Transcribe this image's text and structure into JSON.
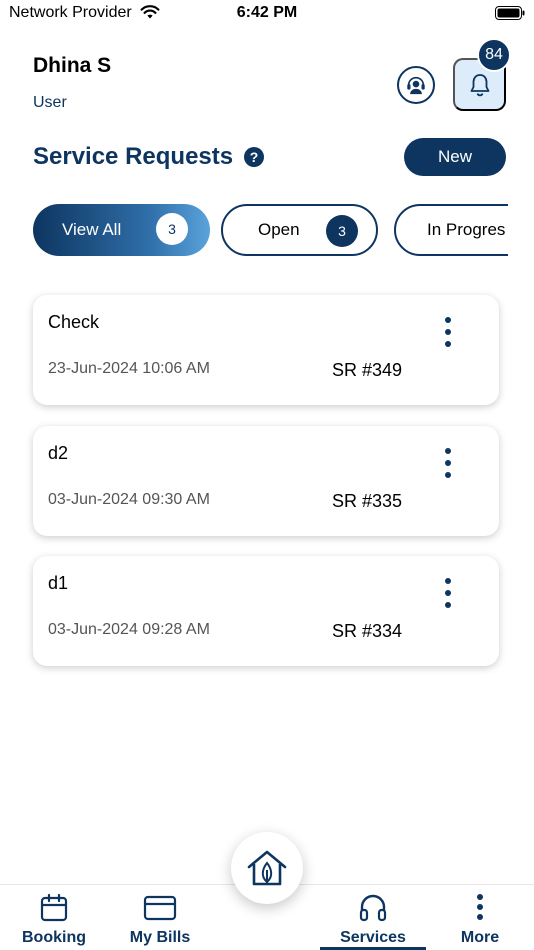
{
  "status_bar": {
    "carrier": "Network Provider",
    "time": "6:42 PM"
  },
  "header": {
    "user_name": "Dhina S",
    "user_role": "User",
    "notification_count": "84",
    "support_icon": "support-agent-icon",
    "bell_icon": "bell-icon"
  },
  "section": {
    "title": "Service Requests",
    "help_symbol": "?",
    "new_button": "New"
  },
  "filters": [
    {
      "label": "View All",
      "count": "3",
      "active": true
    },
    {
      "label": "Open",
      "count": "3",
      "active": false
    },
    {
      "label": "In Progres",
      "count": "",
      "active": false
    }
  ],
  "requests": [
    {
      "title": "Check",
      "date": "23-Jun-2024 10:06 AM",
      "sr": "SR #349"
    },
    {
      "title": "d2",
      "date": "03-Jun-2024 09:30 AM",
      "sr": "SR #335"
    },
    {
      "title": "d1",
      "date": "03-Jun-2024 09:28 AM",
      "sr": "SR #334"
    }
  ],
  "bottom_nav": {
    "items": [
      {
        "label": "Booking",
        "icon": "calendar-icon"
      },
      {
        "label": "My Bills",
        "icon": "card-icon"
      },
      {
        "label": "Services",
        "icon": "headphones-icon",
        "active": true
      },
      {
        "label": "More",
        "icon": "more-vertical-icon"
      }
    ],
    "center_icon": "home-icon"
  },
  "colors": {
    "primary": "#0d3560",
    "accent_light": "#dcecfb",
    "gradient_end": "#5aa3dc"
  }
}
